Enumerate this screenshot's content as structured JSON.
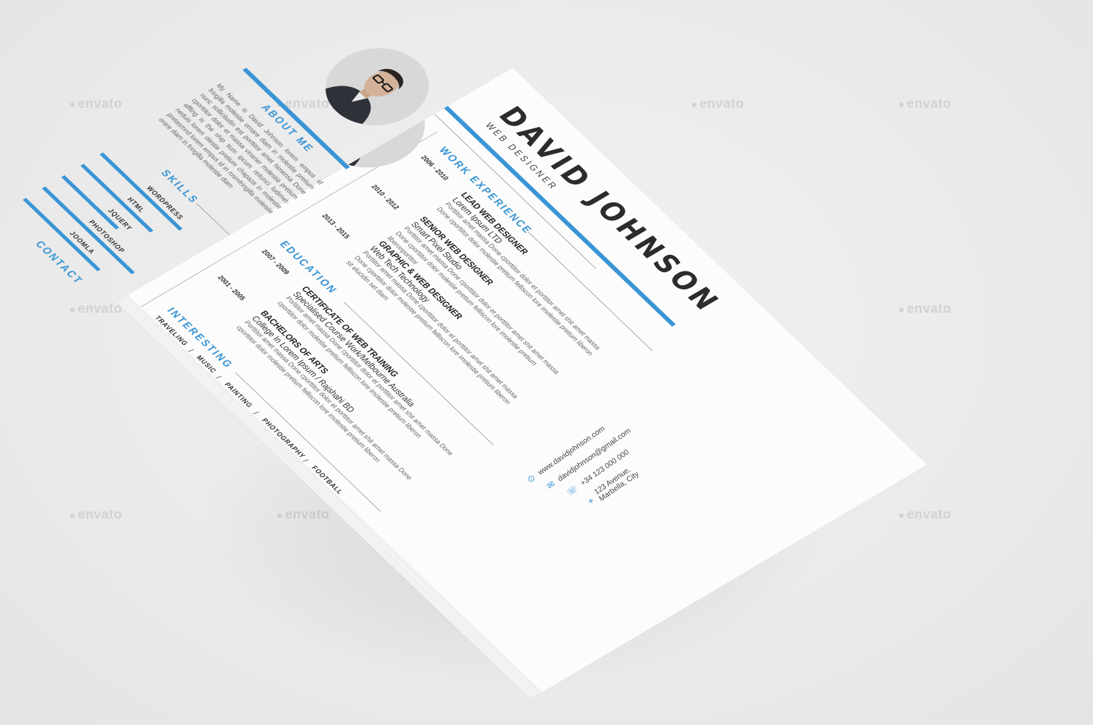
{
  "watermark": {
    "text": "envato"
  },
  "resume": {
    "name": "DAVID JOHNSON",
    "role": "WEB DESIGNER",
    "about": {
      "title": "ABOUT ME",
      "text": "My Name is David Johnson lorem empus id fringilla molestie ornare diam in molestie pretium nunc sollicitudin est porttitor amet himensa Done cporttitor dolor et massa vinarier molestie pretium affling is the ship tium ipcum reitunci ludimet-neduis lorem olestie pretium chapaza in molestie pretasmnd lorem empus id in rosmfringilla molestie orare diam in fringilla molestie diam"
    },
    "experience": {
      "title": "WORK EXPERIENCE",
      "jobs": [
        {
          "dates": "2006 - 2010",
          "title": "LEAD WEB DESIGNER",
          "company": "Lorem Ipsum LTD",
          "text": "Porttitor amet massa Done cporttitor dolor et porttitor amet shit amet massa Done cporttitor dolor molestie pretium felliscon lore imolestie pretium liberon"
        },
        {
          "dates": "2010 - 2012",
          "title": "SENIOR WEB DESIGNER",
          "company": "Smart Pixel Studio",
          "text": "Porttitor amet massa Done cporttitor dolor et porttitor amet shit amet massa Done cporttitor dolor molestie pretium felliscon lore imolestie pretium liberonportitor"
        },
        {
          "dates": "2013 - 2015",
          "title": "GRAPHIC & WEB DESIGNER",
          "company": "Web Tech Technology",
          "text": "Porttitor amet massa Done cporttitor dolor et porttitor amet shit amet massa Done cporttitor dolor molestie pretium felliscon lore imolestie pretium liberon sit elucidin set diam"
        }
      ]
    },
    "education": {
      "title": "EDUCATION",
      "items": [
        {
          "dates": "2007 - 2009",
          "title": "CERTIFICATE OF WEB TRAINING",
          "school": "Specialised Course Work/Melbourne Australia",
          "text": "Porttitor amet massa Done cporttitor dolor et porttitor amet shit amet massa Done cporttitor dolor molestie pretium felliscon lore imolestie pretium liberon"
        },
        {
          "dates": "2001 - 2005",
          "title": "BACHELORS OF ARTS",
          "school": "College In Lorem Ipsum / Rajshahi BD",
          "text": "Porttitor amet massa Done cporttitor dolor et porttitor amet shit amet massa Done cporttitor dolor molestie pretium felliscon lore imolestie pretium liberon"
        }
      ]
    },
    "skills": {
      "title": "SKILLS",
      "items": [
        {
          "name": "WORDPRESS",
          "level": 0.8
        },
        {
          "name": "HTML",
          "level": 0.7
        },
        {
          "name": "JQUERY",
          "level": 0.55
        },
        {
          "name": "PHOTOSHOP",
          "level": 0.9
        },
        {
          "name": "JOOMLA",
          "level": 0.75
        }
      ]
    },
    "contact": {
      "title": "CONTACT",
      "website": "www.davidjohnson.com",
      "email": "davidjohnson@gmail.com",
      "phone": "+34 123 000 000",
      "address": "123 Avenue, Marbella, City"
    },
    "interesting": {
      "title": "INTERESTING",
      "items": [
        "TRAVELING",
        "MUSIC",
        "PAINTING",
        "PHOTOGRAPHY",
        "FOOTBALL"
      ]
    }
  }
}
